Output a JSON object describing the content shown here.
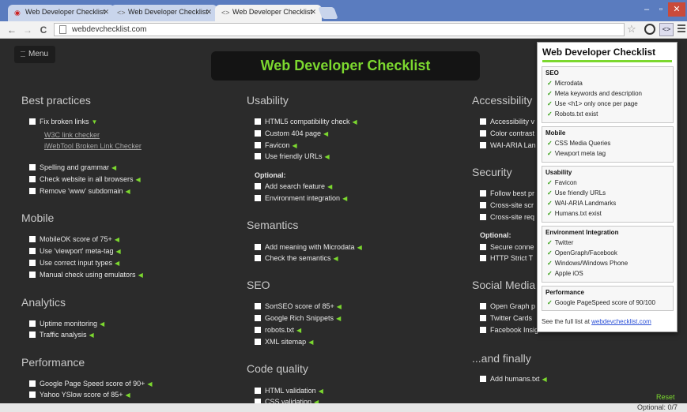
{
  "browser": {
    "tabs": [
      {
        "title": "Web Developer Checklist",
        "active": false
      },
      {
        "title": "Web Developer Checklist",
        "active": false
      },
      {
        "title": "Web Developer Checklist",
        "active": true
      }
    ],
    "url": "webdevchecklist.com",
    "window_controls": {
      "minimize": "–",
      "maximize": "▫",
      "close": "✕"
    }
  },
  "page": {
    "menu_label": "Menu",
    "title": "Web Developer Checklist",
    "reset_label": "Reset",
    "optional_count": "Optional: 0/7",
    "columns": [
      {
        "sections": [
          {
            "heading": "Best practices",
            "items": [
              "Fix broken links",
              "Spelling and grammar",
              "Check website in all browsers",
              "Remove 'www' subdomain"
            ],
            "links": [
              "W3C link checker",
              "iWebTool Broken Link Checker"
            ]
          },
          {
            "heading": "Mobile",
            "items": [
              "MobileOK score of 75+",
              "Use 'viewport' meta-tag",
              "Use correct input types",
              "Manual check using emulators"
            ]
          },
          {
            "heading": "Analytics",
            "items": [
              "Uptime monitoring",
              "Traffic analysis"
            ]
          },
          {
            "heading": "Performance",
            "items": [
              "Google Page Speed score of 90+",
              "Yahoo YSlow score of 85+"
            ]
          }
        ]
      },
      {
        "sections": [
          {
            "heading": "Usability",
            "items": [
              "HTML5 compatibility check",
              "Custom 404 page",
              "Favicon",
              "Use friendly URLs"
            ],
            "optional_label": "Optional:",
            "optional_items": [
              "Add search feature",
              "Environment integration"
            ]
          },
          {
            "heading": "Semantics",
            "items": [
              "Add meaning with Microdata",
              "Check the semantics"
            ]
          },
          {
            "heading": "SEO",
            "items": [
              "SortSEO score of 85+",
              "Google Rich Snippets",
              "robots.txt",
              "XML sitemap"
            ]
          },
          {
            "heading": "Code quality",
            "items": [
              "HTML validation",
              "CSS validation"
            ]
          }
        ]
      },
      {
        "sections": [
          {
            "heading": "Accessibility",
            "items": [
              "Accessibility v",
              "Color contrast",
              "WAI-ARIA Lan"
            ]
          },
          {
            "heading": "Security",
            "items": [
              "Follow best pr",
              "Cross-site scr",
              "Cross-site req"
            ],
            "optional_label": "Optional:",
            "optional_items": [
              "Secure conne",
              "HTTP Strict T"
            ]
          },
          {
            "heading": "Social Media",
            "items": [
              "Open Graph p",
              "Twitter Cards",
              "Facebook Insigh"
            ]
          },
          {
            "heading": "...and finally",
            "items": [
              "Add humans.txt"
            ]
          }
        ]
      }
    ]
  },
  "popup": {
    "title": "Web Developer Checklist",
    "sections": [
      {
        "heading": "SEO",
        "items": [
          "Microdata",
          "Meta keywords and description",
          "Use <h1> only once per page",
          "Robots.txt exist"
        ]
      },
      {
        "heading": "Mobile",
        "items": [
          "CSS Media Queries",
          "Viewport meta tag"
        ]
      },
      {
        "heading": "Usability",
        "items": [
          "Favicon",
          "Use friendly URLs",
          "WAI-ARIA Landmarks",
          "Humans.txt exist"
        ]
      },
      {
        "heading": "Environment Integration",
        "items": [
          "Twitter",
          "OpenGraph/Facebook",
          "Windows/Windows Phone",
          "Apple iOS"
        ]
      },
      {
        "heading": "Performance",
        "items": [
          "Google PageSpeed score of 90/100"
        ]
      }
    ],
    "footer_prefix": "See the full list at",
    "footer_link": "webdevchecklist.com"
  },
  "colors": {
    "accent": "#7cd82f",
    "page_bg": "#2b2b2b",
    "title_bg": "#141414",
    "tabstrip": "#5a7cbf"
  }
}
